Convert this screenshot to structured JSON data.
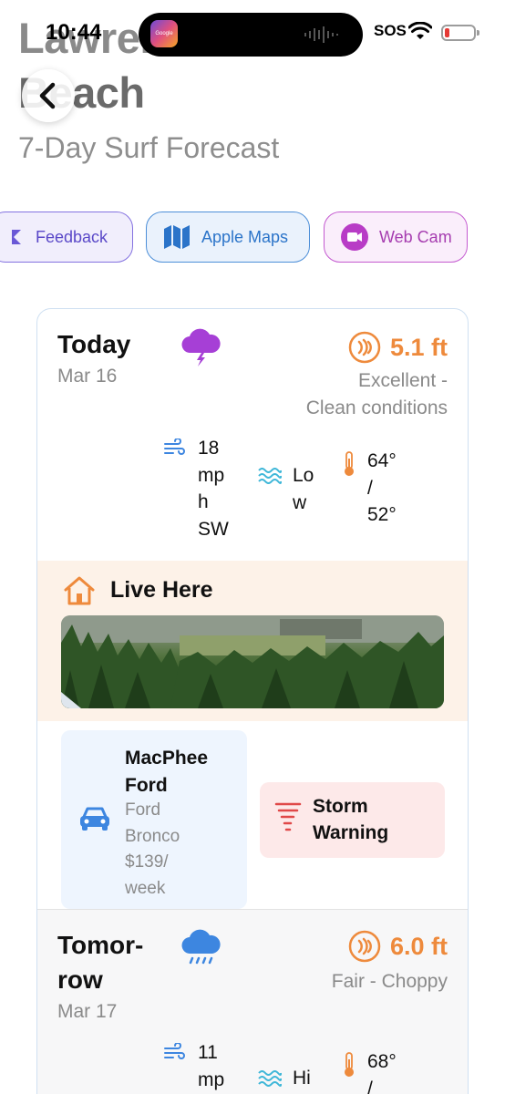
{
  "status_bar": {
    "time": "10:44",
    "island_app_label": "Google",
    "carrier_status": "SOS",
    "battery_level": 0.15
  },
  "header": {
    "title_line1": "Lawrencetown",
    "title_line2": "Beach",
    "subtitle": "7-Day Surf Forecast",
    "back_icon": "chevron-left-icon"
  },
  "actions": [
    {
      "label": "Feedback",
      "icon": "feedback-icon",
      "color": "#5a48c8"
    },
    {
      "label": "Apple Maps",
      "icon": "map-icon",
      "color": "#2b74c9"
    },
    {
      "label": "Web Cam",
      "icon": "video-camera-icon",
      "color": "#a63db0"
    }
  ],
  "forecast": [
    {
      "day": "Today",
      "date": "Mar 16",
      "weather_icon": "thunderstorm-cloud-icon",
      "wave_height": "5.1 ft",
      "condition_line1": "Excellent -",
      "condition_line2": "Clean conditions",
      "wind": [
        "18",
        "mp",
        "h",
        "SW"
      ],
      "tide": [
        "Lo",
        "w"
      ],
      "temp": [
        "64°",
        "/",
        "52°"
      ]
    },
    {
      "day_line1": "Tomor-",
      "day_line2": "row",
      "date": "Mar 17",
      "weather_icon": "rain-cloud-icon",
      "wave_height": "6.0 ft",
      "condition": "Fair - Choppy",
      "wind": [
        "11",
        "mp"
      ],
      "tide": [
        "Hi"
      ],
      "temp": [
        "68°",
        "/"
      ]
    }
  ],
  "sponsors": {
    "live_here": {
      "title": "Live Here",
      "icon": "house-icon"
    },
    "ford": {
      "title_line1": "MacPhee",
      "title_line2": "Ford",
      "detail_line1": "Ford",
      "detail_line2": "Bronco",
      "detail_line3": "$139/",
      "detail_line4": "week",
      "icon": "car-icon"
    },
    "storm": {
      "title_line1": "Storm",
      "title_line2": "Warning",
      "icon": "tornado-icon"
    }
  },
  "colors": {
    "accent_orange": "#ee8a3c",
    "storm_purple": "#a63fd6",
    "rain_blue": "#3d86e0"
  }
}
